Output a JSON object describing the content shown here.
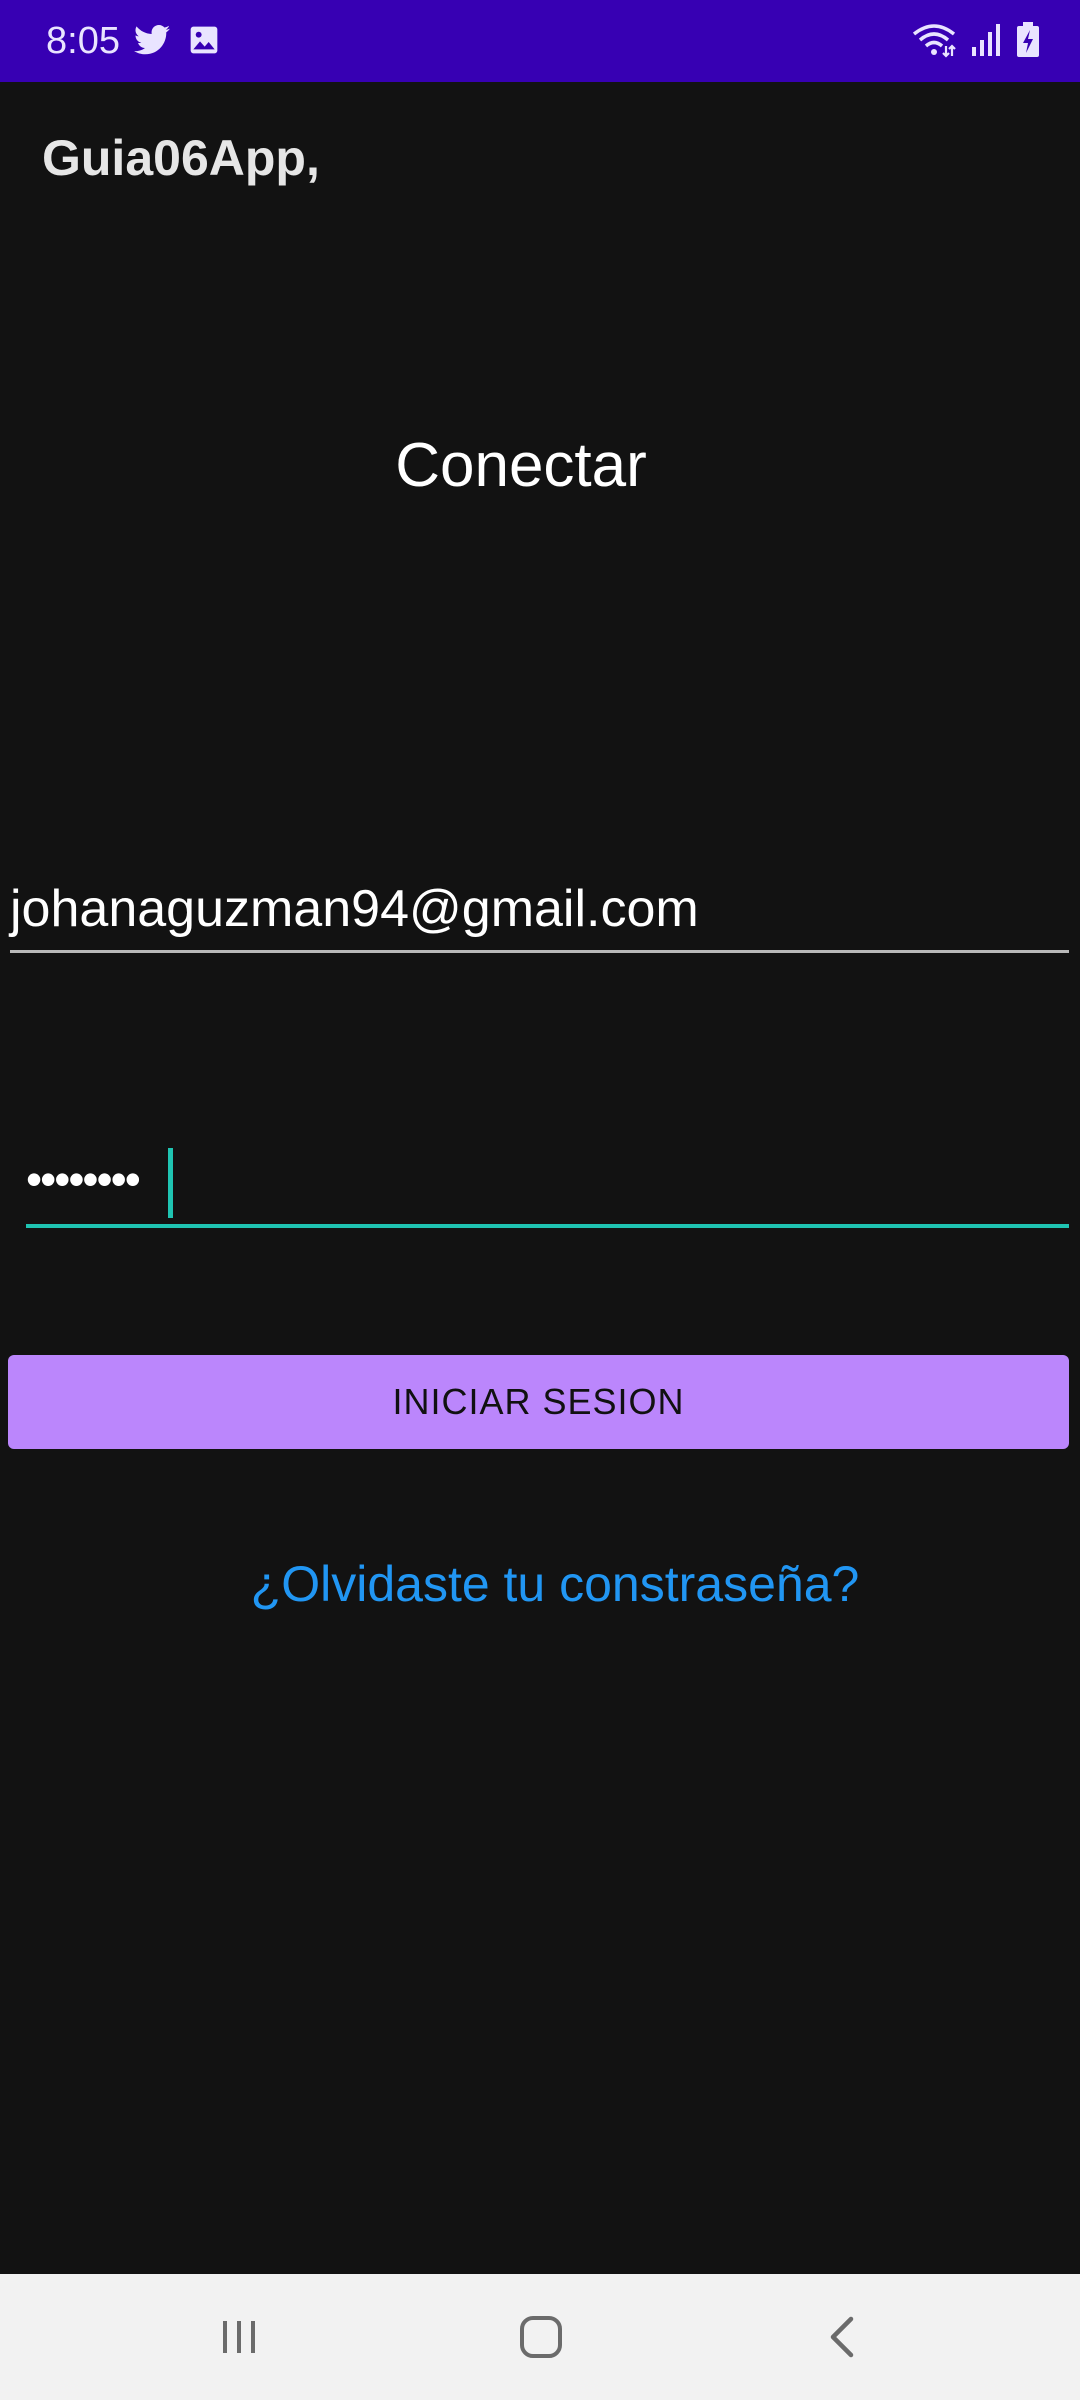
{
  "status_bar": {
    "time": "8:05",
    "left_icons": [
      "twitter-icon",
      "image-icon"
    ],
    "right_icons": [
      "wifi-icon",
      "signal-icon",
      "battery-charging-icon"
    ],
    "background": "#3700b3"
  },
  "app": {
    "title": "Guia06App,"
  },
  "login": {
    "heading": "Conectar",
    "email_value": "johanaguzman94@gmail.com",
    "password_value": "••••••••",
    "button_label": "INICIAR SESION",
    "forgot_link": "¿Olvidaste tu constraseña?"
  },
  "colors": {
    "background": "#121212",
    "accent": "#bb86fc",
    "focus_underline": "#1fc4b2",
    "link": "#2196f3"
  },
  "nav_bar": {
    "buttons": [
      "recents-icon",
      "home-icon",
      "back-icon"
    ]
  }
}
